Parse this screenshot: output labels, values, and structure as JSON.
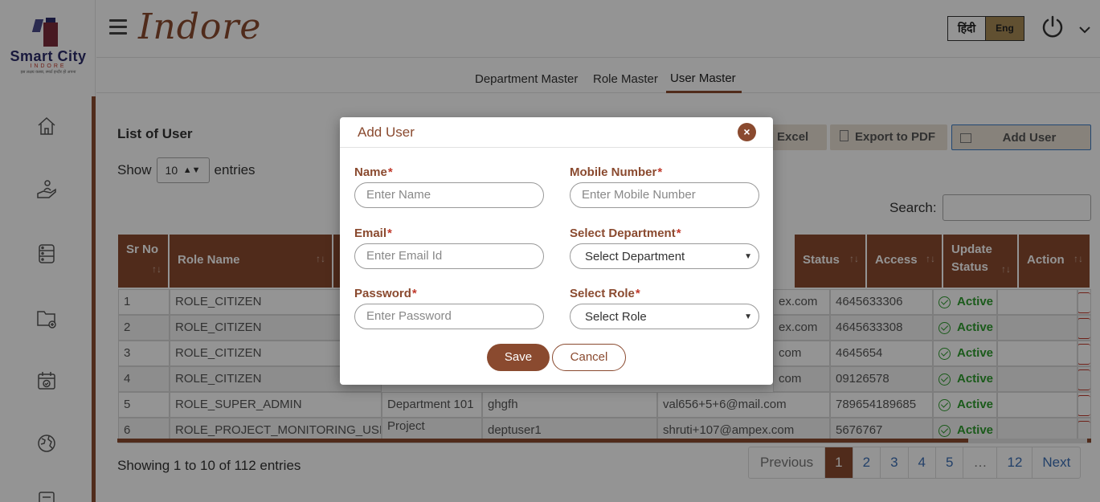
{
  "colors": {
    "brand": "#8a4a2f",
    "status_active": "#2e9c2e",
    "link": "#3b6fb6"
  },
  "logo": {
    "line1": "Smart City",
    "line2": "INDORE",
    "line3": "इस लक्षय कस्बा, स्मार्ट इन्दौर हो अपना"
  },
  "header": {
    "brand": "Indore",
    "lang_hindi": "हिंदी",
    "lang_english": "Eng"
  },
  "tabs": [
    "Department Master",
    "Role Master",
    "User Master"
  ],
  "list": {
    "title": "List of User",
    "show_label": "Show",
    "show_value": "10",
    "entries_label": "entries",
    "search_label": "Search:",
    "excel_label": "Excel",
    "pdf_label": "Export to PDF",
    "add_user_label": "Add User"
  },
  "table": {
    "headers": [
      "Sr No",
      "Role Name",
      "Status",
      "Access",
      "Update Status",
      "Action"
    ],
    "rows": [
      {
        "sr": "1",
        "role": "ROLE_CITIZEN",
        "dept": "",
        "user": "",
        "email": "ex.com",
        "mobile": "4645633306",
        "status": "Active"
      },
      {
        "sr": "2",
        "role": "ROLE_CITIZEN",
        "dept": "",
        "user": "",
        "email": "ex.com",
        "mobile": "4645633308",
        "status": "Active"
      },
      {
        "sr": "3",
        "role": "ROLE_CITIZEN",
        "dept": "",
        "user": "",
        "email": "com",
        "mobile": "4645654",
        "status": "Active"
      },
      {
        "sr": "4",
        "role": "ROLE_CITIZEN",
        "dept": "",
        "user": "",
        "email": "com",
        "mobile": "09126578",
        "status": "Active"
      },
      {
        "sr": "5",
        "role": "ROLE_SUPER_ADMIN",
        "dept": "Department 101",
        "user": "ghgfh",
        "email": "val656+5+6@mail.com",
        "mobile": "789654189685",
        "status": "Active"
      },
      {
        "sr": "6",
        "role": "ROLE_PROJECT_MONITORING_USER",
        "dept": "Project",
        "user": "deptuser1",
        "email": "shruti+107@ampex.com",
        "mobile": "5676767",
        "status": "Active"
      }
    ]
  },
  "footer": {
    "showing": "Showing 1 to 10 of 112 entries",
    "pages": [
      "Previous",
      "1",
      "2",
      "3",
      "4",
      "5",
      "…",
      "12",
      "Next"
    ]
  },
  "modal": {
    "title": "Add User",
    "close": "×",
    "name_label": "Name",
    "name_placeholder": "Enter Name",
    "mobile_label": "Mobile Number",
    "mobile_placeholder": "Enter Mobile Number",
    "email_label": "Email",
    "email_placeholder": "Enter Email Id",
    "department_label": "Select Department",
    "department_value": "Select Department",
    "password_label": "Password",
    "password_placeholder": "Enter Password",
    "role_label": "Select Role",
    "role_value": "Select Role",
    "required_mark": "*",
    "save_label": "Save",
    "cancel_label": "Cancel"
  },
  "icons": {
    "sidebar": [
      "home-icon",
      "hand-user-icon",
      "database-icon",
      "folder-add-icon",
      "calendar-check-icon",
      "globe-icon",
      "document-icon"
    ],
    "header": [
      "menu-icon",
      "power-icon",
      "chevron-down-icon"
    ]
  }
}
